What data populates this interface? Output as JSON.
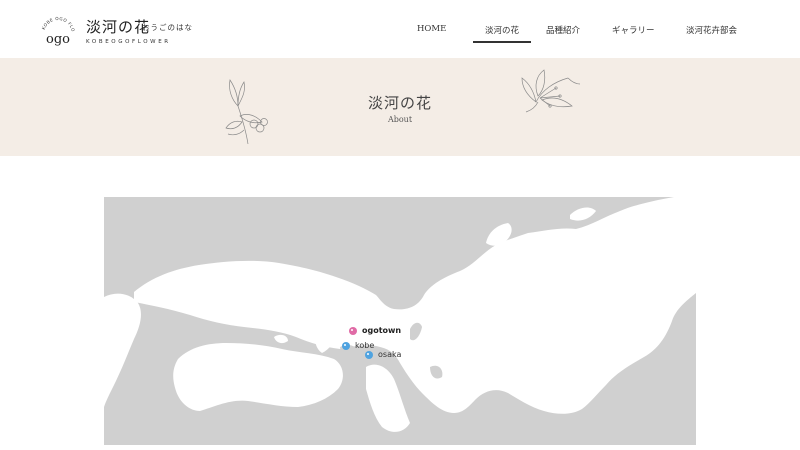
{
  "logo": {
    "arc_text": "KOBE OGO FLOWER",
    "mark_text": "ogo",
    "title": "淡河の花",
    "kana": "おうごのはな",
    "en": "KOBEOGOFLOWER"
  },
  "nav": {
    "items": [
      {
        "label": "HOME",
        "active": false
      },
      {
        "label": "淡河の花",
        "active": true
      },
      {
        "label": "品種紹介",
        "active": false
      },
      {
        "label": "ギャラリー",
        "active": false
      },
      {
        "label": "淡河花卉部会",
        "active": false
      }
    ]
  },
  "hero": {
    "title": "淡河の花",
    "subtitle": "About"
  },
  "map": {
    "pins": [
      {
        "label": "ogotown",
        "color": "#e06ba6"
      },
      {
        "label": "kobe",
        "color": "#4fa3e0"
      },
      {
        "label": "osaka",
        "color": "#4fa3e0"
      }
    ],
    "colors": {
      "land": "#ffffff",
      "sea": "#d0d0d0"
    }
  }
}
